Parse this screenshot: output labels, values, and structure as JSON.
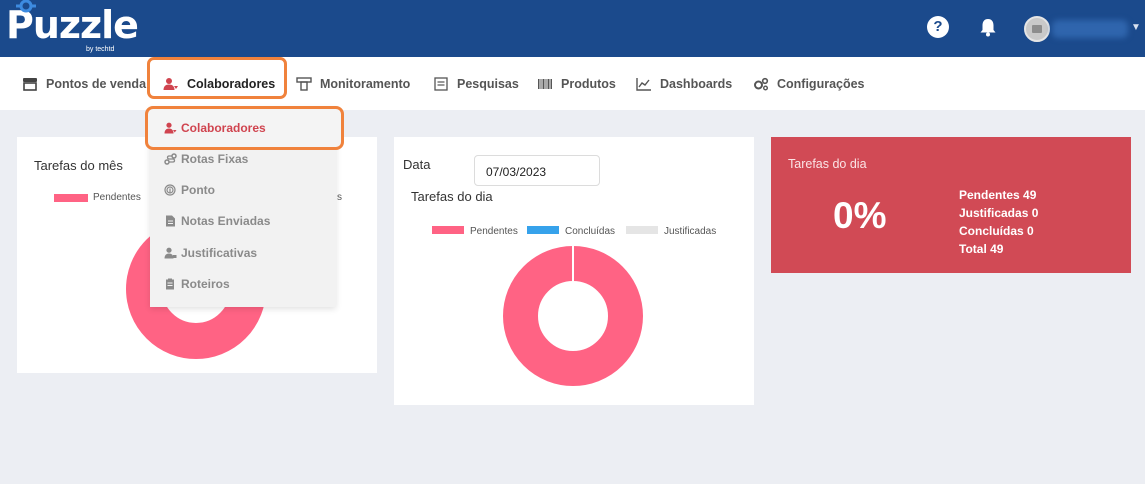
{
  "brand": {
    "name": "Puzzle",
    "byline": "by techtd"
  },
  "header": {
    "help_icon": "question-circle-icon",
    "notifications_icon": "bell-icon",
    "avatar_icon": "user-avatar",
    "menu_caret": "chevron-down-icon"
  },
  "nav": {
    "items": [
      {
        "label": "Pontos de venda",
        "icon": "store-icon"
      },
      {
        "label": "Colaboradores",
        "icon": "users-icon"
      },
      {
        "label": "Monitoramento",
        "icon": "monitor-icon"
      },
      {
        "label": "Pesquisas",
        "icon": "survey-icon"
      },
      {
        "label": "Produtos",
        "icon": "barcode-icon"
      },
      {
        "label": "Dashboards",
        "icon": "chart-line-icon"
      },
      {
        "label": "Configurações",
        "icon": "gears-icon"
      }
    ]
  },
  "dropdown": {
    "items": [
      {
        "label": "Colaboradores",
        "icon": "users-icon"
      },
      {
        "label": "Rotas Fixas",
        "icon": "route-icon"
      },
      {
        "label": "Ponto",
        "icon": "fingerprint-icon"
      },
      {
        "label": "Notas Enviadas",
        "icon": "file-icon"
      },
      {
        "label": "Justificativas",
        "icon": "user-tag-icon"
      },
      {
        "label": "Roteiros",
        "icon": "clipboard-icon"
      }
    ]
  },
  "month_card": {
    "title": "Tarefas do mês",
    "legend": [
      {
        "label": "Pendentes",
        "color": "#ff6384"
      },
      {
        "label": "s",
        "color": "#ff6384"
      }
    ]
  },
  "day_card": {
    "date_label": "Data",
    "date_value": "07/03/2023",
    "title": "Tarefas do dia",
    "legend": [
      {
        "label": "Pendentes",
        "color": "#ff6384"
      },
      {
        "label": "Concluídas",
        "color": "#36a2eb"
      },
      {
        "label": "Justificadas",
        "color": "#e5e5e5"
      }
    ]
  },
  "summary_card": {
    "title": "Tarefas do dia",
    "percent": "0%",
    "stats": [
      "Pendentes 49",
      "Justificadas 0",
      "Concluídas 0",
      "Total 49"
    ]
  },
  "colors": {
    "topbar": "#1b4a8c",
    "accent_red": "#d14a55",
    "highlight_orange": "#f0823c",
    "pending": "#ff6384"
  },
  "chart_data": [
    {
      "type": "pie",
      "title": "Tarefas do dia",
      "categories": [
        "Pendentes",
        "Concluídas",
        "Justificadas"
      ],
      "values": [
        49,
        0,
        0
      ],
      "legend": "top"
    }
  ]
}
